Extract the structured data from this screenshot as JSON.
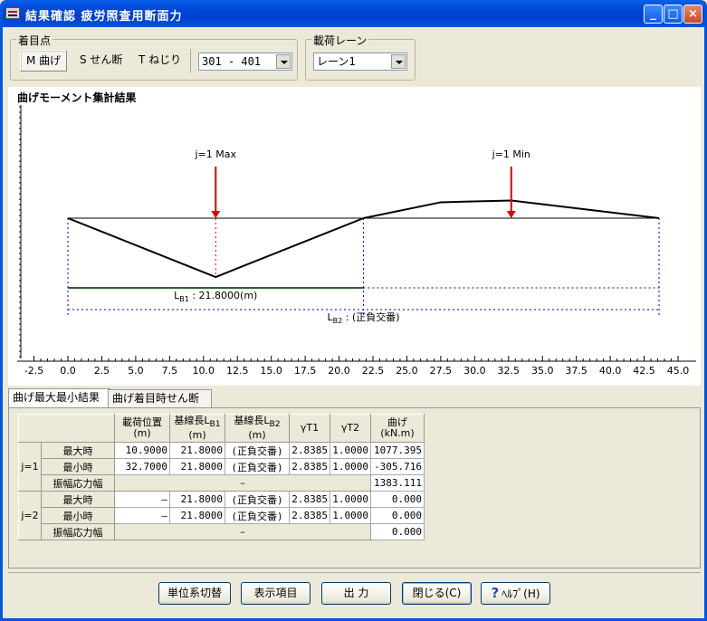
{
  "window": {
    "title": "結果確認 疲労照査用断面力"
  },
  "target_point": {
    "label": "着目点",
    "options": [
      "M 曲げ",
      "S せん断",
      "T ねじり"
    ],
    "selected": "M 曲げ",
    "member_combo": "301 - 401"
  },
  "load_lane": {
    "label": "載荷レーン",
    "combo": "レーン1"
  },
  "chart_data": {
    "type": "line",
    "title": "曲げモーメント集計結果",
    "x_ticks": [
      "-2.5",
      "0.0",
      "2.5",
      "5.0",
      "7.5",
      "10.0",
      "12.5",
      "15.0",
      "17.5",
      "20.0",
      "22.5",
      "25.0",
      "27.5",
      "30.0",
      "32.5",
      "35.0",
      "37.5",
      "40.0",
      "42.5",
      "45.0"
    ],
    "xlim": [
      -2.5,
      45.0
    ],
    "series": [
      {
        "values_x": [
          0.0,
          10.9,
          21.8
        ],
        "values_y": [
          0.0,
          -1.0,
          0.0
        ]
      },
      {
        "values_x": [
          21.8,
          27.5,
          32.7,
          43.6
        ],
        "values_y": [
          0.0,
          0.27,
          0.3,
          0.0
        ]
      }
    ],
    "annotations": {
      "max_label": "j=1 Max",
      "max_x": 10.9,
      "min_label": "j=1 Min",
      "min_x": 32.7,
      "lb1_label": "L",
      "lb1_sub": "B1",
      "lb1_text": ": 21.8000(m)",
      "lb2_label": "L",
      "lb2_sub": "B2",
      "lb2_text": ": (正負交番)",
      "lb1_end": 21.8,
      "lb2_end": 43.6
    }
  },
  "tabs": [
    "曲げ最大最小結果",
    "曲げ着目時せん断"
  ],
  "table": {
    "headers": [
      "載荷位置\n(m)",
      "基線長LB1\n(m)",
      "基線長LB2\n(m)",
      "γT1",
      "γT2",
      "曲げ\n(kN.m)"
    ],
    "groups": [
      {
        "label": "j=1",
        "rows": [
          {
            "name": "最大時",
            "cells": [
              "10.9000",
              "21.8000",
              "(正負交番)",
              "2.8385",
              "1.0000",
              "1077.395"
            ]
          },
          {
            "name": "最小時",
            "cells": [
              "32.7000",
              "21.8000",
              "(正負交番)",
              "2.8385",
              "1.0000",
              "-305.716"
            ]
          },
          {
            "name": "振幅応力幅",
            "span": "–",
            "value": "1383.111"
          }
        ]
      },
      {
        "label": "j=2",
        "rows": [
          {
            "name": "最大時",
            "cells": [
              "–",
              "21.8000",
              "(正負交番)",
              "2.8385",
              "1.0000",
              "0.000"
            ]
          },
          {
            "name": "最小時",
            "cells": [
              "–",
              "21.8000",
              "(正負交番)",
              "2.8385",
              "1.0000",
              "0.000"
            ]
          },
          {
            "name": "振幅応力幅",
            "span": "–",
            "value": "0.000"
          }
        ]
      }
    ]
  },
  "buttons": {
    "unit_switch": "単位系切替",
    "display_items": "表示項目",
    "output": "出 力",
    "close": "閉じる(C)",
    "help": "ﾍﾙﾌﾟ(H)"
  },
  "colors": {
    "arrow": "#e00000",
    "baseline": "#000000",
    "dashed": "#0000cc",
    "lb1_line": "#2e5e2e"
  }
}
